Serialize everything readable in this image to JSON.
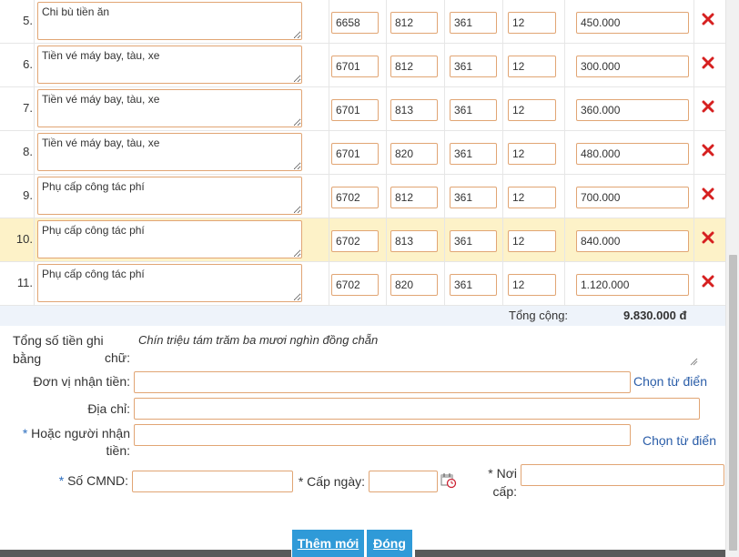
{
  "rows": [
    {
      "index": "5.",
      "description": "Chi bù tiền ăn",
      "c1": "6658",
      "c2": "812",
      "c3": "361",
      "c4": "12",
      "amount": "450.000",
      "highlight": false
    },
    {
      "index": "6.",
      "description": "Tiền vé máy bay, tàu, xe",
      "c1": "6701",
      "c2": "812",
      "c3": "361",
      "c4": "12",
      "amount": "300.000",
      "highlight": false
    },
    {
      "index": "7.",
      "description": "Tiền vé máy bay, tàu, xe",
      "c1": "6701",
      "c2": "813",
      "c3": "361",
      "c4": "12",
      "amount": "360.000",
      "highlight": false
    },
    {
      "index": "8.",
      "description": "Tiền vé máy bay, tàu, xe",
      "c1": "6701",
      "c2": "820",
      "c3": "361",
      "c4": "12",
      "amount": "480.000",
      "highlight": false
    },
    {
      "index": "9.",
      "description": "Phụ cấp công tác phí",
      "c1": "6702",
      "c2": "812",
      "c3": "361",
      "c4": "12",
      "amount": "700.000",
      "highlight": false
    },
    {
      "index": "10.",
      "description": "Phụ cấp công tác phí",
      "c1": "6702",
      "c2": "813",
      "c3": "361",
      "c4": "12",
      "amount": "840.000",
      "highlight": true
    },
    {
      "index": "11.",
      "description": "Phụ cấp công tác phí",
      "c1": "6702",
      "c2": "820",
      "c3": "361",
      "c4": "12",
      "amount": "1.120.000",
      "highlight": false
    }
  ],
  "total": {
    "label": "Tổng cộng:",
    "value": "9.830.000 đ"
  },
  "form": {
    "amount_words_label_1": "Tổng số tiền ghi bằng",
    "amount_words_label_2": "chữ:",
    "amount_words_value": "Chín triệu tám trăm ba mươi nghìn đồng chẵn",
    "recipient_unit_label": "Đơn vị nhận tiền:",
    "recipient_unit_value": "",
    "choose_dictionary_1": "Chọn từ điển",
    "address_label": "Địa chỉ:",
    "address_value": "",
    "person_label_1": "Hoặc người nhận",
    "person_label_2": "tiền:",
    "person_value": "",
    "choose_dictionary_2": "Chọn từ điển",
    "id_label": "Số CMND:",
    "id_value": "",
    "issue_date_label": "Cấp ngày:",
    "issue_date_value": "",
    "issue_place_label_1": "Nơi",
    "issue_place_label_2": "cấp:",
    "issue_place_value": "",
    "required_mark": "*"
  },
  "buttons": {
    "add_new": "Thêm mới",
    "close": "Đóng"
  },
  "colors": {
    "accent": "#2f9ad8",
    "highlight_row": "#fdf2c8",
    "field_border": "#e1a574",
    "delete_red": "#d62020",
    "link": "#2a5da8"
  },
  "icons": {
    "delete": "delete-x-icon",
    "calendar": "calendar-icon"
  }
}
